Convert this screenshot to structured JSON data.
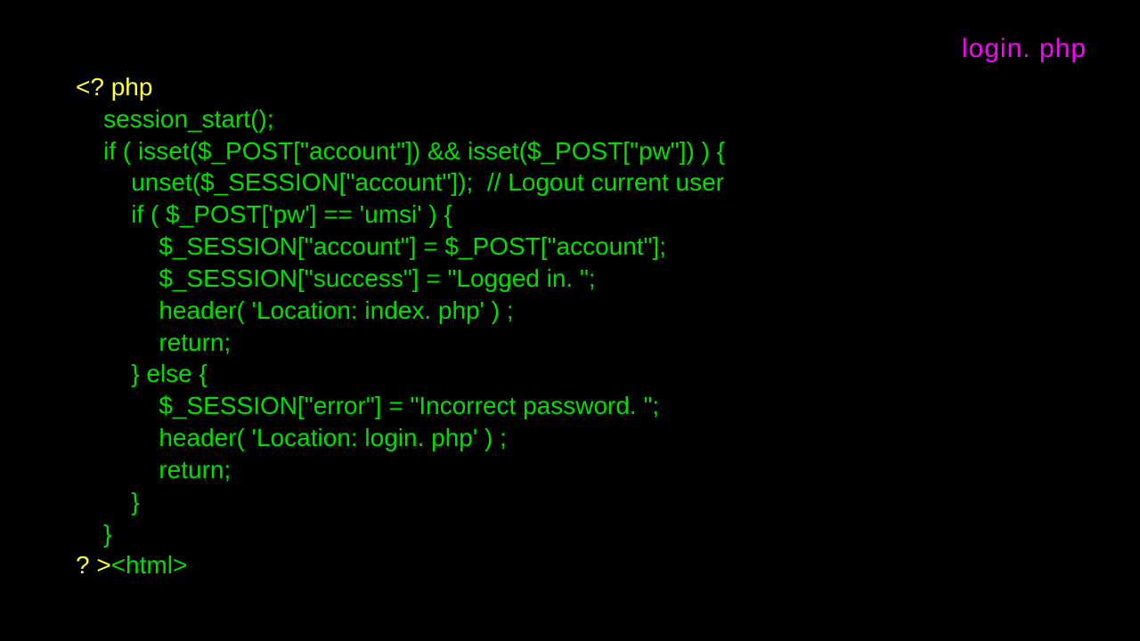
{
  "filename": "login. php",
  "code": {
    "l1": "<? php",
    "l2": "    session_start();",
    "l3": "    if ( isset($_POST[\"account\"]) && isset($_POST[\"pw\"]) ) {",
    "l4": "        unset($_SESSION[\"account\"]);  // Logout current user",
    "l5": "        if ( $_POST['pw'] == 'umsi' ) {",
    "l6": "            $_SESSION[\"account\"] = $_POST[\"account\"];",
    "l7": "            $_SESSION[\"success\"] = \"Logged in. \";",
    "l8": "            header( 'Location: index. php' ) ;",
    "l9": "            return;",
    "l10": "        } else {",
    "l11": "            $_SESSION[\"error\"] = \"Incorrect password. \";",
    "l12": "            header( 'Location: login. php' ) ;",
    "l13": "            return;",
    "l14": "        }",
    "l15": "    }",
    "l16a": "? >",
    "l16b": "<html>"
  }
}
